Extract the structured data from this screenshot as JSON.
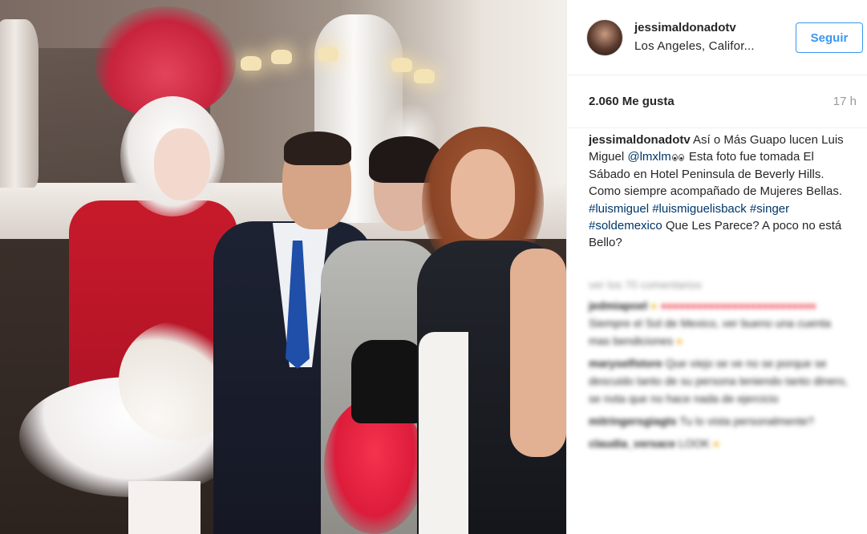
{
  "post": {
    "username": "jessimaldonadotv",
    "location": "Los Angeles, Califor...",
    "follow_label": "Seguir",
    "likes": "2.060 Me gusta",
    "time_ago": "17 h",
    "avatar_icon": "profile-avatar",
    "caption": {
      "username": "jessimaldonadotv",
      "text_1": "Así o Más Guapo lucen Luis Miguel",
      "mention": "@lmxlm",
      "text_2": "Esta foto fue tomada El Sábado en Hotel Peninsula de Beverly Hills. Como siempre acompañado de Mujeres Bellas.",
      "hashtags": "#luismiguel #luismiguelisback #singer #soldemexico",
      "text_3": "Que Les Parece? A poco no está Bello?"
    },
    "see_all_comments": "ver los 70 comentarios",
    "comments": [
      {
        "user": "jedmiapoel",
        "text": "Siempre el Sol de Mexico, ver bueno una cuenta mas bendiciones"
      },
      {
        "user": "maryselfstore",
        "text": "Que viejo se ve no se porque se descuido tanto de su persona teniendo tanto dinero, se nota que no hace nada de ejercicio"
      },
      {
        "user": "mitringersgiagts",
        "text": "Tu lo vista personalmente?"
      },
      {
        "user": "claudia_versace",
        "text": "LOOK"
      }
    ]
  },
  "colors": {
    "accent": "#3897f0",
    "link": "#003569",
    "muted": "#999999",
    "text": "#262626"
  }
}
